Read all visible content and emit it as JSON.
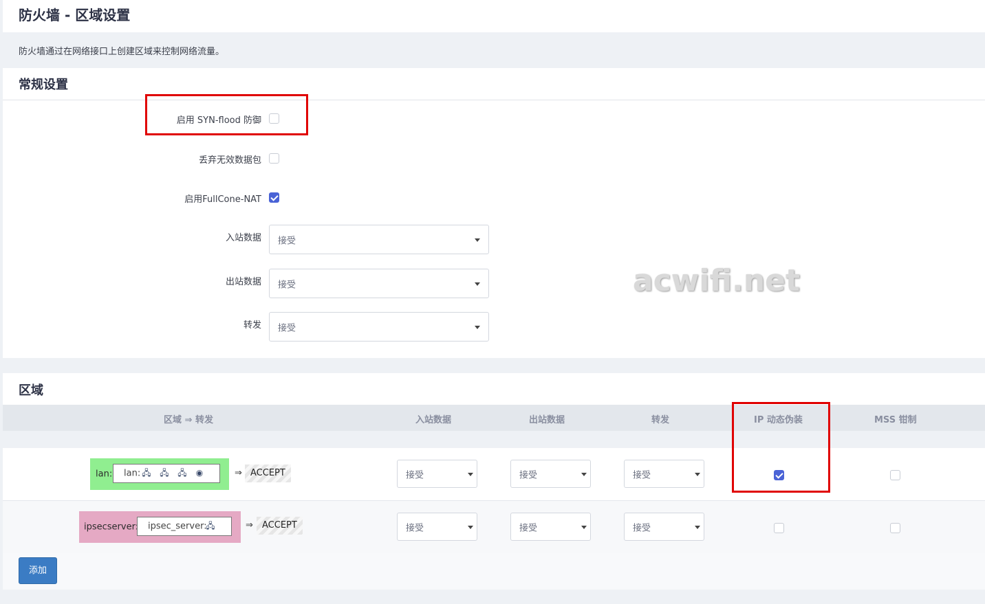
{
  "page": {
    "title": "防火墙 - 区域设置",
    "description": "防火墙通过在网络接口上创建区域来控制网络流量。"
  },
  "general": {
    "section_title": "常规设置",
    "syn_flood": {
      "label": "启用 SYN-flood 防御",
      "checked": false
    },
    "drop_invalid": {
      "label": "丢弃无效数据包",
      "checked": false
    },
    "fullcone": {
      "label": "启用FullCone-NAT",
      "checked": true
    },
    "input": {
      "label": "入站数据",
      "value": "接受"
    },
    "output": {
      "label": "出站数据",
      "value": "接受"
    },
    "forward": {
      "label": "转发",
      "value": "接受"
    }
  },
  "watermark": "acwifi.net",
  "zones": {
    "section_title": "区域",
    "headers": {
      "zone": "区域 ⇒ 转发",
      "input": "入站数据",
      "output": "出站数据",
      "forward": "转发",
      "masq": "IP 动态伪装",
      "mss": "MSS 钳制"
    },
    "rows": [
      {
        "name": "lan:",
        "interface": "lan:",
        "color": "#90ee90",
        "arrow": "⇒",
        "forward_target": "ACCEPT",
        "input": "接受",
        "output": "接受",
        "forward": "接受",
        "masq": true,
        "mss": false
      },
      {
        "name": "ipsecserver:",
        "interface": "ipsec_server:",
        "color": "#e5a9c4",
        "arrow": "⇒",
        "forward_target": "ACCEPT",
        "input": "接受",
        "output": "接受",
        "forward": "接受",
        "masq": false,
        "mss": false
      }
    ],
    "add_label": "添加"
  },
  "colors": {
    "accent": "#4a63d6",
    "button": "#3b7cc4",
    "highlight": "#e00000"
  },
  "icons": [
    "network-port-icon",
    "wifi-icon"
  ]
}
